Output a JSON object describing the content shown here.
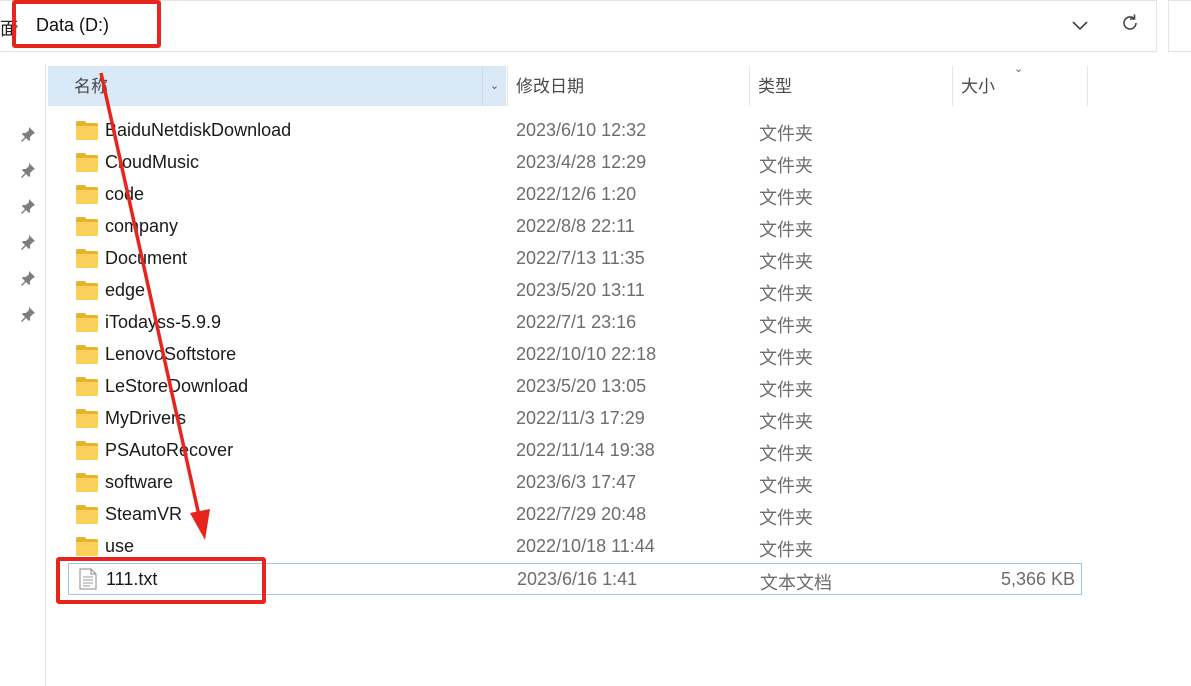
{
  "address_bar": {
    "prev_crumb": "面",
    "current": "Data (D:)"
  },
  "columns": {
    "name": "名称",
    "date": "修改日期",
    "type": "类型",
    "size": "大小"
  },
  "files": [
    {
      "name": "BaiduNetdiskDownload",
      "date": "2023/6/10 12:32",
      "type": "文件夹",
      "size": "",
      "kind": "folder"
    },
    {
      "name": "CloudMusic",
      "date": "2023/4/28 12:29",
      "type": "文件夹",
      "size": "",
      "kind": "folder"
    },
    {
      "name": "code",
      "date": "2022/12/6 1:20",
      "type": "文件夹",
      "size": "",
      "kind": "folder"
    },
    {
      "name": "company",
      "date": "2022/8/8 22:11",
      "type": "文件夹",
      "size": "",
      "kind": "folder"
    },
    {
      "name": "Document",
      "date": "2022/7/13 11:35",
      "type": "文件夹",
      "size": "",
      "kind": "folder"
    },
    {
      "name": "edge",
      "date": "2023/5/20 13:11",
      "type": "文件夹",
      "size": "",
      "kind": "folder"
    },
    {
      "name": "iTodayss-5.9.9",
      "date": "2022/7/1 23:16",
      "type": "文件夹",
      "size": "",
      "kind": "folder"
    },
    {
      "name": "LenovoSoftstore",
      "date": "2022/10/10 22:18",
      "type": "文件夹",
      "size": "",
      "kind": "folder"
    },
    {
      "name": "LeStoreDownload",
      "date": "2023/5/20 13:05",
      "type": "文件夹",
      "size": "",
      "kind": "folder"
    },
    {
      "name": "MyDrivers",
      "date": "2022/11/3 17:29",
      "type": "文件夹",
      "size": "",
      "kind": "folder"
    },
    {
      "name": "PSAutoRecover",
      "date": "2022/11/14 19:38",
      "type": "文件夹",
      "size": "",
      "kind": "folder"
    },
    {
      "name": "software",
      "date": "2023/6/3 17:47",
      "type": "文件夹",
      "size": "",
      "kind": "folder"
    },
    {
      "name": "SteamVR",
      "date": "2022/7/29 20:48",
      "type": "文件夹",
      "size": "",
      "kind": "folder"
    },
    {
      "name": "use",
      "date": "2022/10/18 11:44",
      "type": "文件夹",
      "size": "",
      "kind": "folder"
    },
    {
      "name": "111.txt",
      "date": "2023/6/16 1:41",
      "type": "文本文档",
      "size": "5,366 KB",
      "kind": "text-file"
    }
  ],
  "selected_row": 14,
  "quick_access_pins": 6,
  "colors": {
    "header_highlight": "#dae9f8",
    "selection_border": "#99c8ec",
    "annotation": "#e8251c",
    "folder": "#fbd05a"
  },
  "icons": {
    "addr_dropdown": "chevron-down-icon",
    "refresh": "refresh-icon",
    "pin": "pin-icon",
    "folder": "folder-icon",
    "text_file": "text-file-icon"
  }
}
